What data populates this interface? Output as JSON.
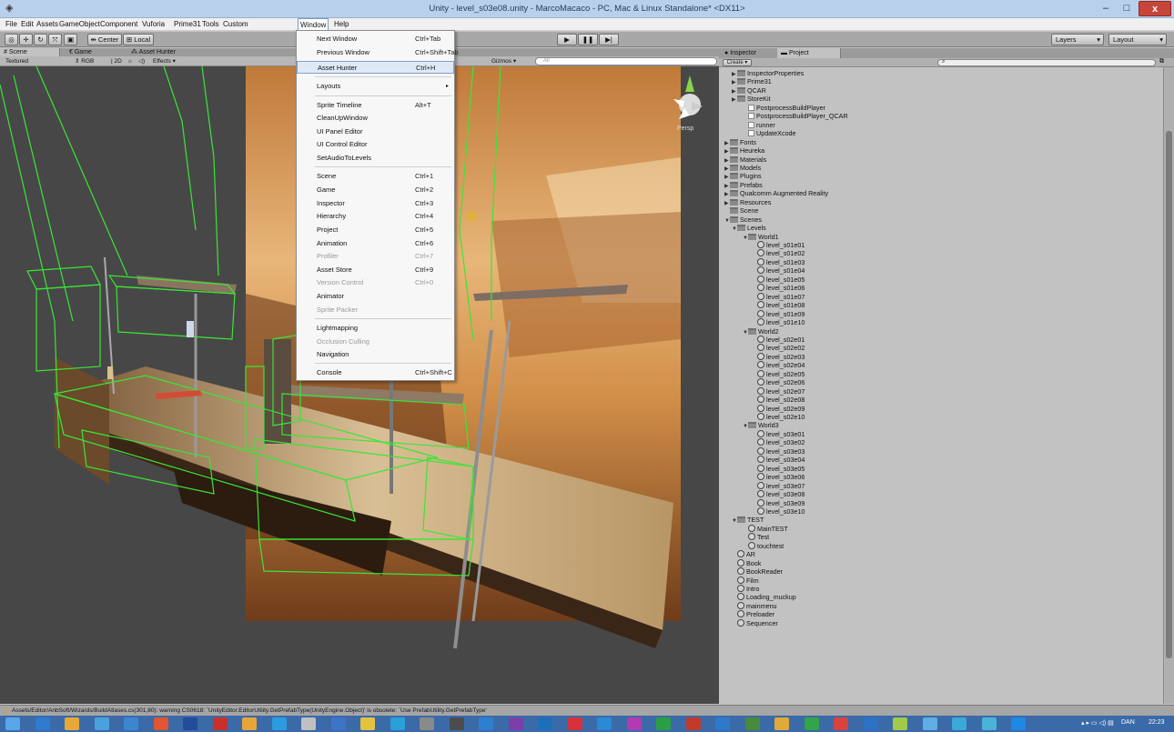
{
  "window": {
    "title": "Unity - level_s03e08.unity - MarcoMacaco - PC, Mac & Linux Standalone* <DX11>",
    "minimize": "–",
    "maximize": "□",
    "close": "x"
  },
  "menu": {
    "items": [
      "File",
      "Edit",
      "Assets",
      "GameObject",
      "Component",
      "Vuforia",
      "Prime31",
      "Tools",
      "Custom",
      "Window",
      "Help"
    ],
    "active": "Window"
  },
  "toolbar": {
    "center": "Center",
    "local": "Local",
    "layers": "Layers",
    "layout": "Layout"
  },
  "scene_tabs": {
    "scene": "Scene",
    "game": "Game",
    "asset_hunter": "Asset Hunter"
  },
  "scene_bar": {
    "textured": "Textured",
    "rgb": "RGB",
    "mode_2d": "2D",
    "effects": "Effects",
    "gizmos": "Gizmos",
    "search_placeholder": "All"
  },
  "viewport": {
    "persp": "Persp"
  },
  "window_menu": [
    {
      "label": "Next Window",
      "shortcut": "Ctrl+Tab"
    },
    {
      "label": "Previous Window",
      "shortcut": "Ctrl+Shift+Tab"
    },
    {
      "label": "Asset Hunter",
      "shortcut": "Ctrl+H",
      "highlighted": true
    },
    {
      "label": "Layouts",
      "shortcut": ""
    },
    {
      "label": "Sprite Timeline",
      "shortcut": "Alt+T"
    },
    {
      "label": "CleanUpWindow",
      "shortcut": ""
    },
    {
      "label": "UI Panel Editor",
      "shortcut": ""
    },
    {
      "label": "UI Control Editor",
      "shortcut": ""
    },
    {
      "label": "SetAudioToLevels",
      "shortcut": ""
    },
    {
      "label": "Scene",
      "shortcut": "Ctrl+1"
    },
    {
      "label": "Game",
      "shortcut": "Ctrl+2"
    },
    {
      "label": "Inspector",
      "shortcut": "Ctrl+3"
    },
    {
      "label": "Hierarchy",
      "shortcut": "Ctrl+4"
    },
    {
      "label": "Project",
      "shortcut": "Ctrl+5"
    },
    {
      "label": "Animation",
      "shortcut": "Ctrl+6"
    },
    {
      "label": "Profiler",
      "shortcut": "Ctrl+7",
      "disabled": true
    },
    {
      "label": "Asset Store",
      "shortcut": "Ctrl+9"
    },
    {
      "label": "Version Control",
      "shortcut": "Ctrl+0",
      "disabled": true
    },
    {
      "label": "Animator",
      "shortcut": ""
    },
    {
      "label": "Sprite Packer",
      "shortcut": "",
      "disabled": true
    },
    {
      "label": "Lightmapping",
      "shortcut": ""
    },
    {
      "label": "Occlusion Culling",
      "shortcut": "",
      "disabled": true
    },
    {
      "label": "Navigation",
      "shortcut": ""
    },
    {
      "label": "Console",
      "shortcut": "Ctrl+Shift+C"
    }
  ],
  "right_tabs": {
    "inspector": "Inspector",
    "project": "Project",
    "create": "Create"
  },
  "project_tree": [
    {
      "label": "InspectorProperties",
      "type": "folder",
      "indent": 1,
      "arrow": "▶"
    },
    {
      "label": "Prime31",
      "type": "folder",
      "indent": 1,
      "arrow": "▶"
    },
    {
      "label": "QCAR",
      "type": "folder",
      "indent": 1,
      "arrow": "▶"
    },
    {
      "label": "StoreKit",
      "type": "folder",
      "indent": 1,
      "arrow": "▶"
    },
    {
      "label": "PostprocessBuildPlayer",
      "type": "file",
      "indent": 2
    },
    {
      "label": "PostprocessBuildPlayer_QCAR",
      "type": "file",
      "indent": 2
    },
    {
      "label": "runner",
      "type": "file",
      "indent": 2
    },
    {
      "label": "UpdateXcode",
      "type": "file",
      "indent": 2
    },
    {
      "label": "Fonts",
      "type": "folder",
      "indent": 0,
      "arrow": "▶"
    },
    {
      "label": "Heureka",
      "type": "folder",
      "indent": 0,
      "arrow": "▶"
    },
    {
      "label": "Materials",
      "type": "folder",
      "indent": 0,
      "arrow": "▶"
    },
    {
      "label": "Models",
      "type": "folder",
      "indent": 0,
      "arrow": "▶"
    },
    {
      "label": "Plugins",
      "type": "folder",
      "indent": 0,
      "arrow": "▶"
    },
    {
      "label": "Prefabs",
      "type": "folder",
      "indent": 0,
      "arrow": "▶"
    },
    {
      "label": "Qualcomm Augmented Reality",
      "type": "folder",
      "indent": 0,
      "arrow": "▶"
    },
    {
      "label": "Resources",
      "type": "folder",
      "indent": 0,
      "arrow": "▶"
    },
    {
      "label": "Scene",
      "type": "folder",
      "indent": 0
    },
    {
      "label": "Scenes",
      "type": "folder",
      "indent": 0,
      "arrow": "▼"
    },
    {
      "label": "Levels",
      "type": "folder",
      "indent": 1,
      "arrow": "▼"
    },
    {
      "label": "World1",
      "type": "folder",
      "indent": 2,
      "arrow": "▼"
    },
    {
      "label": "level_s01e01",
      "type": "scene",
      "indent": 3
    },
    {
      "label": "level_s01e02",
      "type": "scene",
      "indent": 3
    },
    {
      "label": "level_s01e03",
      "type": "scene",
      "indent": 3
    },
    {
      "label": "level_s01e04",
      "type": "scene",
      "indent": 3
    },
    {
      "label": "level_s01e05",
      "type": "scene",
      "indent": 3
    },
    {
      "label": "level_s01e06",
      "type": "scene",
      "indent": 3
    },
    {
      "label": "level_s01e07",
      "type": "scene",
      "indent": 3
    },
    {
      "label": "level_s01e08",
      "type": "scene",
      "indent": 3
    },
    {
      "label": "level_s01e09",
      "type": "scene",
      "indent": 3
    },
    {
      "label": "level_s01e10",
      "type": "scene",
      "indent": 3
    },
    {
      "label": "World2",
      "type": "folder",
      "indent": 2,
      "arrow": "▼"
    },
    {
      "label": "level_s02e01",
      "type": "scene",
      "indent": 3
    },
    {
      "label": "level_s02e02",
      "type": "scene",
      "indent": 3
    },
    {
      "label": "level_s02e03",
      "type": "scene",
      "indent": 3
    },
    {
      "label": "level_s02e04",
      "type": "scene",
      "indent": 3
    },
    {
      "label": "level_s02e05",
      "type": "scene",
      "indent": 3
    },
    {
      "label": "level_s02e06",
      "type": "scene",
      "indent": 3
    },
    {
      "label": "level_s02e07",
      "type": "scene",
      "indent": 3
    },
    {
      "label": "level_s02e08",
      "type": "scene",
      "indent": 3
    },
    {
      "label": "level_s02e09",
      "type": "scene",
      "indent": 3
    },
    {
      "label": "level_s02e10",
      "type": "scene",
      "indent": 3
    },
    {
      "label": "World3",
      "type": "folder",
      "indent": 2,
      "arrow": "▼"
    },
    {
      "label": "level_s03e01",
      "type": "scene",
      "indent": 3
    },
    {
      "label": "level_s03e02",
      "type": "scene",
      "indent": 3
    },
    {
      "label": "level_s03e03",
      "type": "scene",
      "indent": 3
    },
    {
      "label": "level_s03e04",
      "type": "scene",
      "indent": 3
    },
    {
      "label": "level_s03e05",
      "type": "scene",
      "indent": 3
    },
    {
      "label": "level_s03e06",
      "type": "scene",
      "indent": 3
    },
    {
      "label": "level_s03e07",
      "type": "scene",
      "indent": 3
    },
    {
      "label": "level_s03e08",
      "type": "scene",
      "indent": 3
    },
    {
      "label": "level_s03e09",
      "type": "scene",
      "indent": 3
    },
    {
      "label": "level_s03e10",
      "type": "scene",
      "indent": 3
    },
    {
      "label": "TEST",
      "type": "folder",
      "indent": 1,
      "arrow": "▼"
    },
    {
      "label": "MainTEST",
      "type": "scene",
      "indent": 2
    },
    {
      "label": "Test",
      "type": "scene",
      "indent": 2
    },
    {
      "label": "touchtest",
      "type": "scene",
      "indent": 2
    },
    {
      "label": "AR",
      "type": "scene",
      "indent": 1
    },
    {
      "label": "Book",
      "type": "scene",
      "indent": 1
    },
    {
      "label": "BookReader",
      "type": "scene",
      "indent": 1
    },
    {
      "label": "Film",
      "type": "scene",
      "indent": 1
    },
    {
      "label": "Intro",
      "type": "scene",
      "indent": 1
    },
    {
      "label": "Loading_muckup",
      "type": "scene",
      "indent": 1
    },
    {
      "label": "mainmenu",
      "type": "scene",
      "indent": 1
    },
    {
      "label": "Preloader",
      "type": "scene",
      "indent": 1
    },
    {
      "label": "Sequencer",
      "type": "scene",
      "indent": 1
    }
  ],
  "status": {
    "message": "Assets/Editor/AnbSoft/Wizards/BuildAtlases.cs(301,80): warning CS0618: `UnityEditor.EditorUtility.GetPrefabType(UnityEngine.Object)' is obsolete: `Use PrefabUtility.GetPrefabType'"
  },
  "taskbar": {
    "language": "DAN",
    "time": "22:23"
  },
  "colors": {
    "gizmo_green": "#39e636",
    "highlight_border": "#7da2ce",
    "taskbar": "#3b6aa8",
    "close_button": "#c8453a"
  }
}
